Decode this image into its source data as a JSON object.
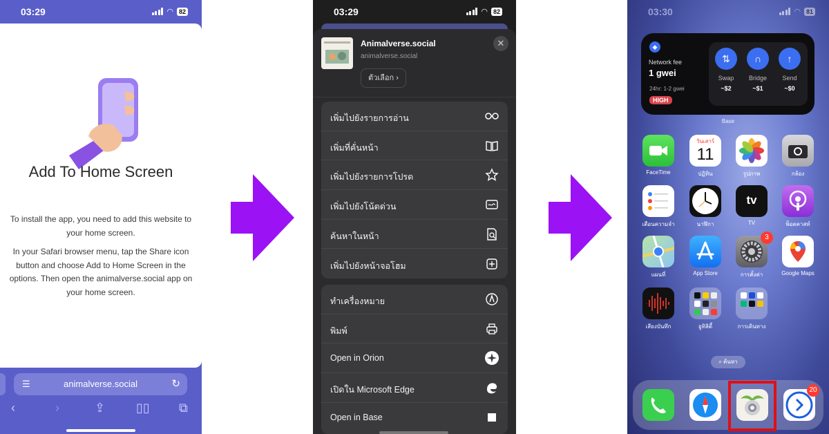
{
  "panel1": {
    "status_time": "03:29",
    "battery": "82",
    "title": "Add To Home Screen",
    "desc1": "To install the app, you need to add this website to your home screen.",
    "desc2": "In your Safari browser menu, tap the Share icon button and choose Add to Home Screen in the options. Then open the animalverse.social app on your home screen.",
    "url": "animalverse.social"
  },
  "panel2": {
    "status_time": "03:29",
    "battery": "82",
    "site_name": "Animalverse.social",
    "site_url": "animalverse.social",
    "options_label": "ตัวเลือก",
    "group1": [
      {
        "label": "เพิ่มไปยังรายการอ่าน",
        "icon": "glasses-icon"
      },
      {
        "label": "เพิ่มที่คั่นหน้า",
        "icon": "book-icon"
      },
      {
        "label": "เพิ่มไปยังรายการโปรด",
        "icon": "star-icon"
      },
      {
        "label": "เพิ่มไปยังโน้ตด่วน",
        "icon": "quick-note-icon"
      },
      {
        "label": "ค้นหาในหน้า",
        "icon": "find-in-page-icon"
      },
      {
        "label": "เพิ่มไปยังหน้าจอโฮม",
        "icon": "add-square-icon"
      }
    ],
    "group2": [
      {
        "label": "ทำเครื่องหมาย",
        "icon": "markup-icon"
      },
      {
        "label": "พิมพ์",
        "icon": "printer-icon"
      },
      {
        "label": "Open in Orion",
        "icon": "orion-icon"
      },
      {
        "label": "เปิดใน Microsoft Edge",
        "icon": "edge-icon"
      },
      {
        "label": "Open in Base",
        "icon": "base-square-icon"
      }
    ],
    "highlight_color": "#e10f14"
  },
  "panel3": {
    "status_time": "03:30",
    "battery": "81",
    "widget": {
      "network_fee_label": "Network fee",
      "gwei": "1 gwei",
      "range_24h": "24hr: 1-2 gwei",
      "level": "HIGH",
      "actions": [
        {
          "name": "Swap",
          "value": "~$2",
          "icon": "swap-icon"
        },
        {
          "name": "Bridge",
          "value": "~$1",
          "icon": "bridge-icon"
        },
        {
          "name": "Send",
          "value": "~$0",
          "icon": "arrow-up-icon"
        }
      ],
      "caption": "Base"
    },
    "calendar_day": "วันเสาร์",
    "calendar_date": "11",
    "tv_label": "tv",
    "apps": [
      {
        "name": "FaceTime"
      },
      {
        "name": "ปฏิทิน"
      },
      {
        "name": "รูปภาพ"
      },
      {
        "name": "กล้อง"
      },
      {
        "name": "เตือนความจำ"
      },
      {
        "name": "นาฬิกา"
      },
      {
        "name": "TV"
      },
      {
        "name": "พ็อดคาสท์"
      },
      {
        "name": "แผนที่"
      },
      {
        "name": "App Store"
      },
      {
        "name": "การตั้งค่า",
        "badge": "3"
      },
      {
        "name": "Google Maps"
      },
      {
        "name": "เสียงบันทึก"
      },
      {
        "name": "ยูทิลิตี้"
      },
      {
        "name": "การเดินทาง"
      }
    ],
    "search_label": "ค้นหา",
    "dock_badge": "20",
    "highlight_color": "#e10f14"
  },
  "arrow_color": "#9b12f5"
}
